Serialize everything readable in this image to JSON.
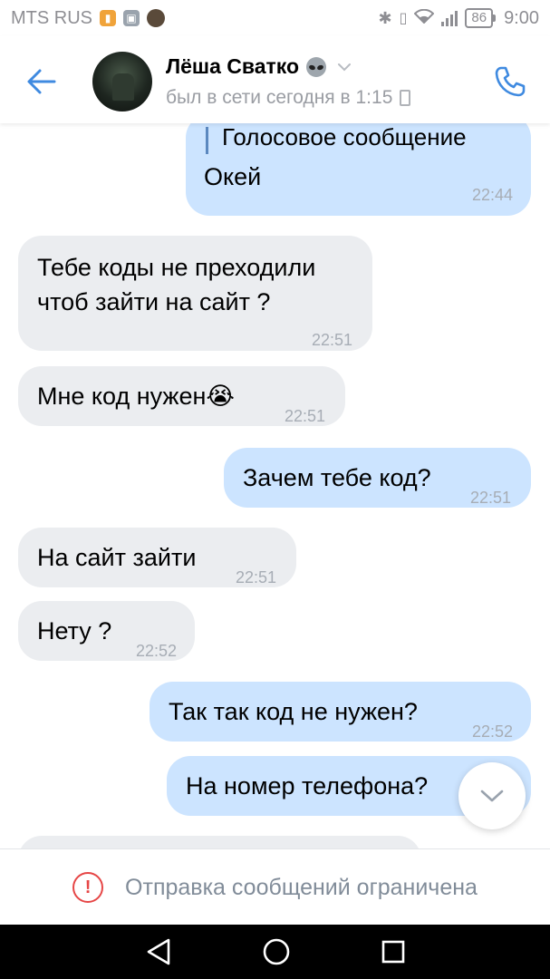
{
  "status_bar": {
    "carrier": "MTS RUS",
    "battery": "86",
    "time": "9:00"
  },
  "header": {
    "name": "Лёша Сватко",
    "last_seen": "был в сети сегодня в 1:15"
  },
  "messages": [
    {
      "side": "out",
      "quote": "Голосовое сообщение",
      "text": "Окей",
      "time": "22:44"
    },
    {
      "side": "in",
      "line1": "Тебе коды не преходили",
      "line2": "чтоб зайти на сайт ?",
      "time": "22:51"
    },
    {
      "side": "in",
      "text": "Мне код нужен😭",
      "time": "22:51"
    },
    {
      "side": "out",
      "text": "Зачем тебе код?",
      "time": "22:51"
    },
    {
      "side": "in",
      "text": "На сайт зайти",
      "time": "22:51"
    },
    {
      "side": "in",
      "text": "Нету ?",
      "time": "22:52"
    },
    {
      "side": "out",
      "text": "Так так код не нужен?",
      "time": "22:52"
    },
    {
      "side": "out",
      "text": "На номер телефона?",
      "time": ""
    }
  ],
  "composer": {
    "restriction": "Отправка сообщений ограничена"
  },
  "colors": {
    "accent": "#3f8ae0",
    "incoming_bubble": "#ebedf0",
    "outgoing_bubble": "#cce4ff",
    "alert": "#e64646"
  },
  "icons": [
    "back-arrow-icon",
    "alien-icon",
    "chevron-down-icon",
    "phone-icon",
    "alert-icon",
    "chevron-down-icon",
    "back-triangle-icon",
    "home-circle-icon",
    "recents-square-icon"
  ]
}
